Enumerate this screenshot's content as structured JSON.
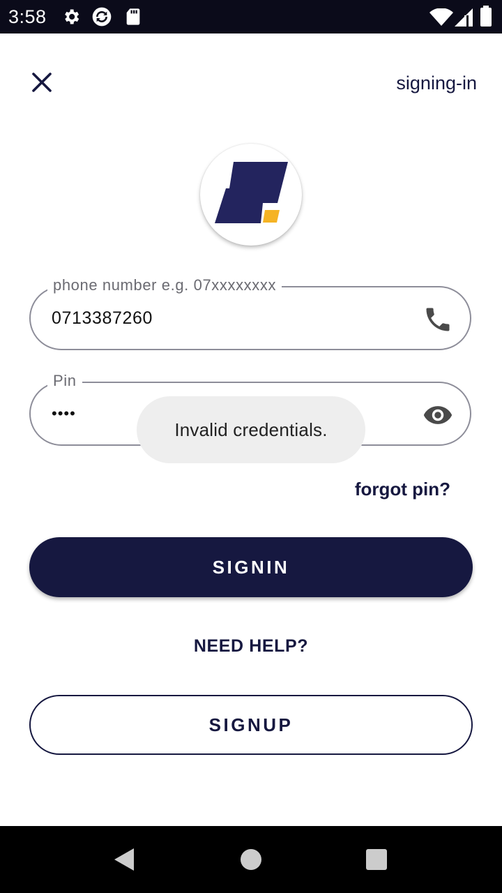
{
  "status_bar": {
    "time": "3:58",
    "icons": [
      "gear-icon",
      "sync-icon",
      "sd-card-icon",
      "wifi-icon",
      "signal-icon",
      "battery-icon"
    ]
  },
  "header": {
    "close_icon": "close-icon",
    "title_link": "signing-in"
  },
  "logo": {
    "colors": {
      "primary": "#23245e",
      "accent": "#f5b324"
    }
  },
  "form": {
    "phone": {
      "label": "phone number e.g. 07xxxxxxxx",
      "value": "0713387260",
      "icon": "phone-icon"
    },
    "pin": {
      "label": "Pin",
      "value": "••••",
      "icon": "eye-icon"
    },
    "forgot_label": "forgot pin?"
  },
  "toast": {
    "message": "Invalid credentials."
  },
  "actions": {
    "signin_label": "SIGNIN",
    "help_label": "NEED HELP?",
    "signup_label": "SIGNUP"
  },
  "nav_bar": {
    "icons": [
      "back-icon",
      "home-icon",
      "recents-icon"
    ]
  },
  "colors": {
    "brand": "#161840",
    "status_bar": "#0b0b1a",
    "toast_bg": "#eeeeee"
  }
}
